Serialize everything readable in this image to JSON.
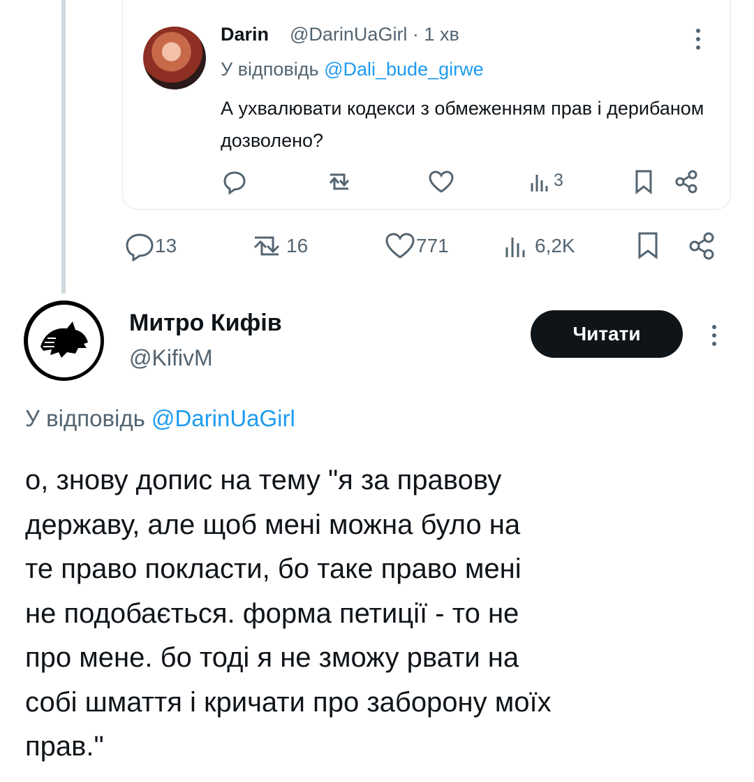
{
  "quoted_reply": {
    "author_name": "Darin",
    "meta": "@DarinUaGirl · 1 хв",
    "reply_prefix": "У відповідь",
    "reply_to": "@Dali_bude_girwe",
    "text": "А ухвалювати кодекси з обмеженням прав і дерибаном дозволено?",
    "views": "3",
    "icons": [
      "reply-icon",
      "retweet-icon",
      "like-icon",
      "views-icon",
      "bookmark-icon",
      "share-icon",
      "more-icon"
    ]
  },
  "parent_stats": {
    "replies": "13",
    "retweets": "16",
    "likes": "771",
    "views": "6,2K"
  },
  "post": {
    "author_name": "Митро Кифів",
    "handle": "@KifivM",
    "follow_label": "Читати",
    "reply_prefix": "У відповідь",
    "reply_to": "@DarinUaGirl",
    "text": "о, знову допис на тему \"я за правову\nдержаву, але щоб мені можна було на\nте право покласти, бо таке право мені\nне подобається.  форма петиції - то не\nпро мене. бо тоді я не зможу рвати на\nсобі шмаття і кричати про заборону моїх\nправ.\""
  },
  "colors": {
    "link": "#1d9bf0",
    "muted": "#536471",
    "text": "#0f1419",
    "button": "#0f1419"
  }
}
